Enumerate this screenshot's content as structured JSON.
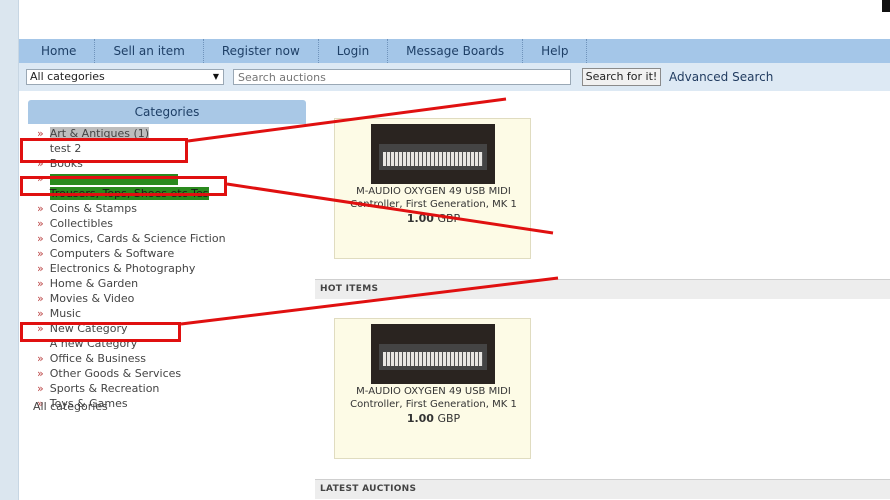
{
  "nav": {
    "items": [
      "Home",
      "Sell an item",
      "Register now",
      "Login",
      "Message Boards",
      "Help"
    ]
  },
  "search": {
    "category_value": "All categories",
    "placeholder": "Search auctions",
    "button_label": "Search for it!",
    "advanced_label": "Advanced Search"
  },
  "categories": {
    "header": "Categories",
    "items": [
      {
        "label": "Art & Antiques (1)",
        "highlight": "gray"
      },
      {
        "label": "test 2",
        "highlight": "none"
      },
      {
        "label": "Books",
        "highlight": "none"
      },
      {
        "label": "",
        "highlight": "green"
      },
      {
        "label": "Trousers, Tops, Shoes etc Tes",
        "highlight": "green"
      },
      {
        "label": "Coins & Stamps",
        "highlight": "none"
      },
      {
        "label": "Collectibles",
        "highlight": "none"
      },
      {
        "label": "Comics, Cards & Science Fiction",
        "highlight": "none"
      },
      {
        "label": "Computers & Software",
        "highlight": "none"
      },
      {
        "label": "Electronics & Photography",
        "highlight": "none"
      },
      {
        "label": "Home & Garden",
        "highlight": "none"
      },
      {
        "label": "Movies & Video",
        "highlight": "none"
      },
      {
        "label": "Music",
        "highlight": "none"
      },
      {
        "label": "New Category",
        "highlight": "none"
      },
      {
        "label": "A new Category",
        "highlight": "none"
      },
      {
        "label": "Office & Business",
        "highlight": "none"
      },
      {
        "label": "Other Goods & Services",
        "highlight": "none"
      },
      {
        "label": "Sports & Recreation",
        "highlight": "none"
      },
      {
        "label": "Toys & Games",
        "highlight": "none"
      }
    ],
    "all_label": "All categories"
  },
  "featured": {
    "title_line1": "M-AUDIO OXYGEN 49 USB MIDI",
    "title_line2": "Controller, First Generation, MK 1",
    "price_amount": "1.00",
    "price_currency": "GBP"
  },
  "sections": {
    "hot_items": "HOT ITEMS",
    "latest_auctions": "LATEST AUCTIONS"
  },
  "hot_item": {
    "title_line1": "M-AUDIO OXYGEN 49 USB MIDI",
    "title_line2": "Controller, First Generation, MK 1",
    "price_amount": "1.00",
    "price_currency": "GBP"
  },
  "colors": {
    "nav_bg": "#a4c6e8",
    "annotation_red": "#e01010",
    "category_green": "#2a8a1e"
  }
}
